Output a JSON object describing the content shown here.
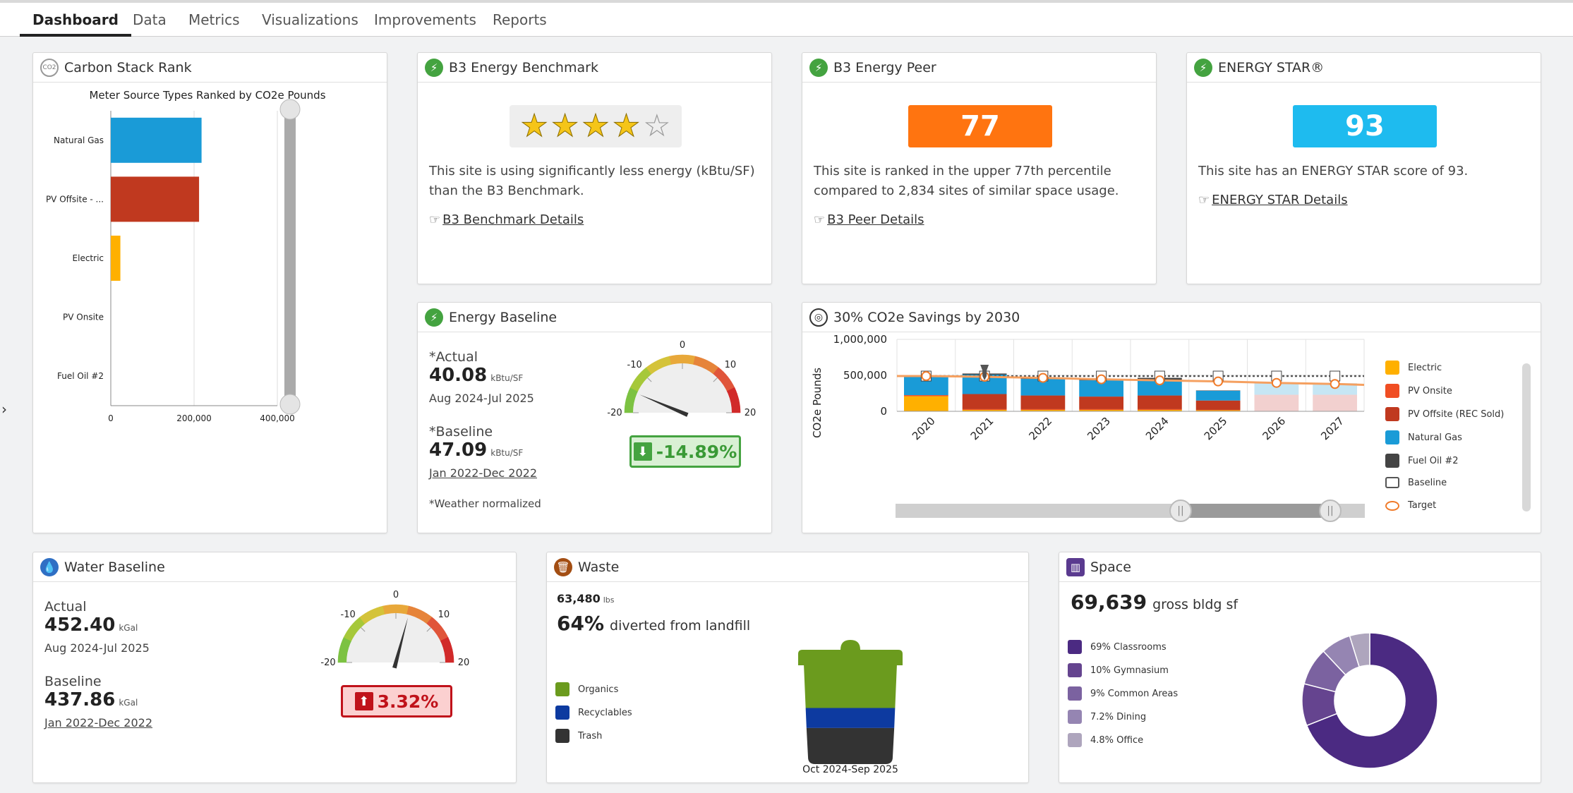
{
  "tabs": [
    "Dashboard",
    "Data",
    "Metrics",
    "Visualizations",
    "Improvements",
    "Reports"
  ],
  "carbon": {
    "title": "Carbon Stack Rank",
    "icon_text": "CO2",
    "chart_data": {
      "type": "bar",
      "orientation": "horizontal",
      "title": "Meter Source Types Ranked by CO2e Pounds",
      "categories": [
        "Natural Gas",
        "PV Offsite - ...",
        "Electric",
        "PV Onsite",
        "Fuel Oil #2"
      ],
      "values": [
        218000,
        212000,
        23000,
        0,
        0
      ],
      "colors": [
        "#1a9bd7",
        "#c0391f",
        "#ffb000",
        "#888888",
        "#444444"
      ],
      "xlim": [
        0,
        400000
      ],
      "xticks": [
        "0",
        "200,000",
        "400,000"
      ]
    }
  },
  "benchmark": {
    "title": "B3 Energy Benchmark",
    "stars_filled": 4,
    "stars_total": 5,
    "text": "This site is using significantly less energy (kBtu/SF) than the B3 Benchmark.",
    "link": "B3 Benchmark Details"
  },
  "peer": {
    "title": "B3 Energy Peer",
    "score": "77",
    "color": "#ff7410",
    "text": "This site is ranked in the upper 77th percentile compared to 2,834 sites of similar space usage.",
    "link": "B3 Peer Details"
  },
  "energystar": {
    "title": "ENERGY STAR®",
    "score": "93",
    "color": "#1ebbef",
    "text": "This site has an ENERGY STAR score of 93.",
    "link": "ENERGY STAR Details"
  },
  "energy_baseline": {
    "title": "Energy Baseline",
    "actual_label": "*Actual",
    "actual_value": "40.08",
    "actual_unit": "kBtu/SF",
    "actual_period": "Aug 2024-Jul 2025",
    "baseline_label": "*Baseline",
    "baseline_value": "47.09",
    "baseline_unit": "kBtu/SF",
    "baseline_period": "Jan 2022-Dec 2022",
    "note": "*Weather normalized",
    "gauge_ticks": [
      "-20",
      "-10",
      "0",
      "10",
      "20"
    ],
    "gauge_value": -14.89,
    "change": "-14.89%",
    "change_arrow": "⬇"
  },
  "savings": {
    "title": "30% CO2e Savings by 2030",
    "chart_data": {
      "type": "bar",
      "stacked": true,
      "ylabel": "CO2e Pounds",
      "yticks": [
        "1,000,000",
        "500,000",
        "0"
      ],
      "ylim": [
        0,
        1000000
      ],
      "categories": [
        "2020",
        "2021",
        "2022",
        "2023",
        "2024",
        "2025",
        "2026",
        "2027"
      ],
      "series": [
        {
          "name": "Electric",
          "color": "#ffb000",
          "values": [
            210000,
            20000,
            20000,
            20000,
            20000,
            15000,
            0,
            0
          ]
        },
        {
          "name": "PV Onsite",
          "color": "#f04e23",
          "values": [
            15000,
            10000,
            10000,
            10000,
            10000,
            5000,
            0,
            0
          ]
        },
        {
          "name": "PV Offsite (REC Sold)",
          "color": "#c0391f",
          "values": [
            0,
            210000,
            190000,
            175000,
            190000,
            130000,
            230000,
            230000
          ]
        },
        {
          "name": "Natural Gas",
          "color": "#1a9bd7",
          "values": [
            255000,
            270000,
            230000,
            225000,
            210000,
            135000,
            160000,
            160000
          ]
        },
        {
          "name": "Fuel Oil #2",
          "color": "#444444",
          "values": [
            0,
            15000,
            15000,
            15000,
            35000,
            5000,
            0,
            0
          ]
        }
      ],
      "baseline": [
        490000,
        490000,
        490000,
        490000,
        490000,
        490000,
        490000,
        490000
      ],
      "target": [
        490000,
        480000,
        465000,
        445000,
        430000,
        415000,
        395000,
        380000
      ],
      "legend": [
        "Electric",
        "PV Onsite",
        "PV Offsite (REC Sold)",
        "Natural Gas",
        "Fuel Oil #2",
        "Baseline",
        "Target"
      ],
      "baseline_color": "#555555",
      "target_color": "#f5a060"
    }
  },
  "water": {
    "title": "Water Baseline",
    "actual_label": "Actual",
    "actual_value": "452.40",
    "actual_unit": "kGal",
    "actual_period": "Aug 2024-Jul 2025",
    "baseline_label": "Baseline",
    "baseline_value": "437.86",
    "baseline_unit": "kGal",
    "baseline_period": "Jan 2022-Dec 2022",
    "gauge_ticks": [
      "-20",
      "-10",
      "0",
      "10",
      "20"
    ],
    "gauge_value": 3.32,
    "change": "3.32%",
    "change_arrow": "⬆"
  },
  "waste": {
    "title": "Waste",
    "total_value": "63,480",
    "total_unit": "lbs",
    "diverted_pct": "64%",
    "diverted_text": "diverted from landfill",
    "legend": [
      {
        "label": "Organics",
        "color": "#6b9b1e"
      },
      {
        "label": "Recyclables",
        "color": "#0d3aa0"
      },
      {
        "label": "Trash",
        "color": "#333333"
      }
    ],
    "fractions": [
      0.44,
      0.2,
      0.36
    ],
    "period": "Oct 2024-Sep 2025"
  },
  "space": {
    "title": "Space",
    "area_value": "69,639",
    "area_text": "gross bldg sf",
    "chart_data": {
      "type": "pie",
      "donut": true,
      "labels": [
        "69% Classrooms",
        "10% Gymnasium",
        "9% Common Areas",
        "7.2% Dining",
        "4.8% Office"
      ],
      "values": [
        69,
        10,
        9,
        7.2,
        4.8
      ],
      "colors": [
        "#4b2a82",
        "#65448f",
        "#7b62a0",
        "#9585b2",
        "#aea5bd"
      ]
    }
  }
}
